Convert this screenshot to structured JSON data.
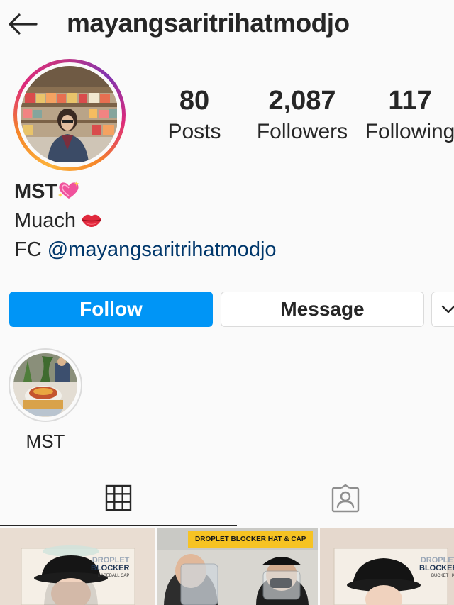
{
  "header": {
    "back_icon": "arrow-left-icon",
    "username": "mayangsaritrihatmodjo"
  },
  "stats": {
    "posts": {
      "value": "80",
      "label": "Posts"
    },
    "followers": {
      "value": "2,087",
      "label": "Followers"
    },
    "following": {
      "value": "117",
      "label": "Following"
    }
  },
  "bio": {
    "name": "MST",
    "name_emoji": "sparkling-heart-icon",
    "line2": "Muach",
    "line2_emoji": "lips-icon",
    "line3_prefix": "FC ",
    "line3_link": "@mayangsaritrihatmodjo"
  },
  "actions": {
    "follow_label": "Follow",
    "message_label": "Message",
    "more_icon": "chevron-down-icon"
  },
  "highlights": [
    {
      "label": "MST"
    }
  ],
  "tabs": {
    "grid_icon": "grid-icon",
    "tagged_icon": "tagged-person-icon"
  },
  "posts": [
    {
      "brand_line1": "DROPLET",
      "brand_line2": "BLOCKER",
      "brand_line3": "BASEBALL CAP"
    },
    {
      "banner": "DROPLET BLOCKER HAT & CAP"
    },
    {
      "brand_line1": "DROPLET",
      "brand_line2": "BLOCKER",
      "brand_line3": "BUCKET HAT"
    }
  ],
  "colors": {
    "accent_blue": "#0095f6",
    "link_blue": "#00376b",
    "text": "#262626",
    "border": "#dbdbdb",
    "background": "#fafafa"
  }
}
